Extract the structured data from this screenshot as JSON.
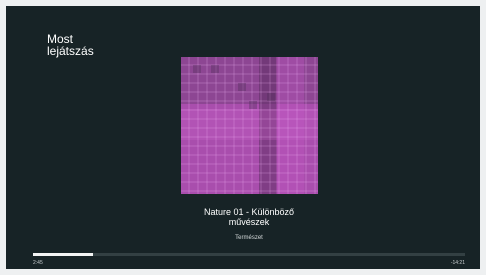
{
  "page": {
    "title": "Most\nlejátszás"
  },
  "track": {
    "title": "Nature 01 - Különböző\nművészek",
    "subtitle": "Természet",
    "album_art": "purple-grid-artwork"
  },
  "playback": {
    "elapsed": "2:45",
    "remaining": "-14:21",
    "progress_fraction": 0.14
  },
  "colors": {
    "background": "#172326",
    "text": "#ffffff",
    "progress_fill": "#f3f4f4",
    "artwork_purple": "#a24da6"
  }
}
